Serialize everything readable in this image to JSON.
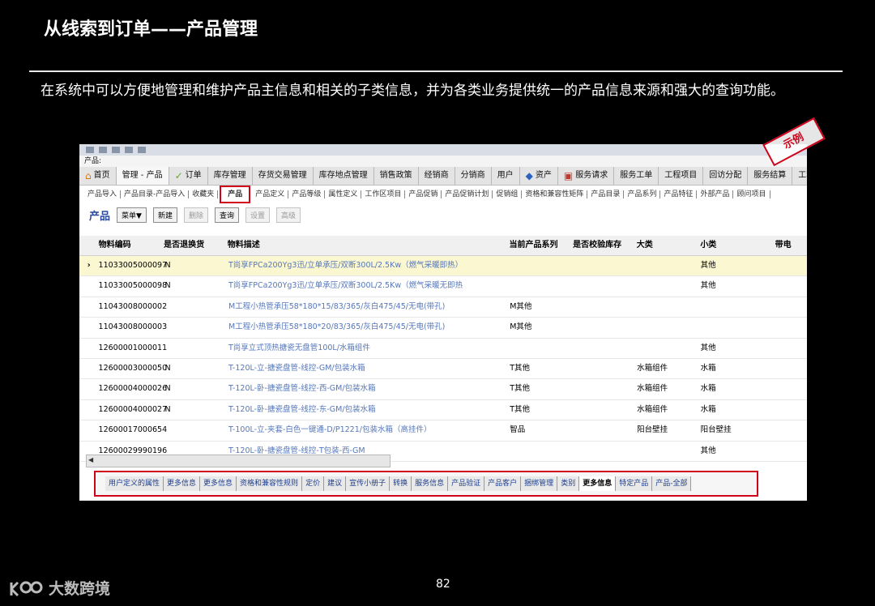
{
  "slide": {
    "title": "从线索到订单——产品管理",
    "description": "在系统中可以方便地管理和维护产品主信息和相关的子类信息，并为各类业务提供统一的产品信息来源和强大的查询功能。",
    "page_number": "82",
    "logo_text": "大数跨境",
    "stamp_text": "示例"
  },
  "app": {
    "breadcrumb": "产品:",
    "tabs": [
      {
        "label": "首页",
        "icon": "home-icon"
      },
      {
        "label": "管理 - 产品",
        "icon": ""
      },
      {
        "label": "订单",
        "icon": "order-icon"
      },
      {
        "label": "库存管理",
        "icon": ""
      },
      {
        "label": "存货交易管理",
        "icon": ""
      },
      {
        "label": "库存地点管理",
        "icon": ""
      },
      {
        "label": "销售政策",
        "icon": ""
      },
      {
        "label": "经销商",
        "icon": ""
      },
      {
        "label": "分销商",
        "icon": ""
      },
      {
        "label": "用户",
        "icon": ""
      },
      {
        "label": "资产",
        "icon": "asset-icon"
      },
      {
        "label": "服务请求",
        "icon": "briefcase-icon"
      },
      {
        "label": "服务工单",
        "icon": ""
      },
      {
        "label": "工程项目",
        "icon": ""
      },
      {
        "label": "回访分配",
        "icon": ""
      },
      {
        "label": "服务结算",
        "icon": ""
      },
      {
        "label": "工程",
        "icon": ""
      }
    ],
    "subtabs": [
      "产品导入",
      "产品目录-产品导入",
      "收藏夹",
      "产品",
      "产品定义",
      "产品等级",
      "属性定义",
      "工作区项目",
      "产品促销",
      "产品促销计划",
      "促销组",
      "资格和兼容性矩阵",
      "产品目录",
      "产品系列",
      "产品特征",
      "外部产品",
      "顾问项目"
    ],
    "active_subtab": "产品",
    "section_title": "产品",
    "menu_button": "菜单▼",
    "buttons": {
      "new": "新建",
      "delete": "删除",
      "query": "查询",
      "btn4": "设置",
      "btn5": "高级"
    },
    "columns": [
      "物料编码",
      "是否退换货",
      "物料描述",
      "当前产品系列",
      "是否校验库存",
      "大类",
      "小类",
      "带电"
    ],
    "rows": [
      {
        "code": "11033005000097",
        "returnable": "N",
        "desc": "T尚享FPCa200Yg3迅/立单承压/双断300L/2.5Kw（燃气采暖即热）",
        "series": "",
        "check_stock": "",
        "category": "",
        "subcategory": "其他",
        "selected": true
      },
      {
        "code": "11033005000098",
        "returnable": "N",
        "desc": "T尚享FPCa200Yg3迅/立单承压/双断300L/2.5Kw（燃气采暖无即热",
        "series": "",
        "check_stock": "",
        "category": "",
        "subcategory": "其他"
      },
      {
        "code": "11043008000002",
        "returnable": "",
        "desc": "M工程小热管承压58*180*15/83/365/灰白475/45/无电(带孔)",
        "series": "M其他",
        "check_stock": "",
        "category": "",
        "subcategory": ""
      },
      {
        "code": "11043008000003",
        "returnable": "",
        "desc": "M工程小热管承压58*180*20/83/365/灰白475/45/无电(带孔)",
        "series": "M其他",
        "check_stock": "",
        "category": "",
        "subcategory": ""
      },
      {
        "code": "12600001000011",
        "returnable": "",
        "desc": "T尚享立式顶热搪瓷无盘管100L/水箱组件",
        "series": "",
        "check_stock": "",
        "category": "",
        "subcategory": "其他"
      },
      {
        "code": "12600003000050",
        "returnable": "N",
        "desc": "T-120L-立-搪瓷盘管-线控-GM/包装水箱",
        "series": "T其他",
        "check_stock": "",
        "category": "水箱组件",
        "subcategory": "水箱"
      },
      {
        "code": "12600004000026",
        "returnable": "N",
        "desc": "T-120L-卧-搪瓷盘管-线控-西-GM/包装水箱",
        "series": "T其他",
        "check_stock": "",
        "category": "水箱组件",
        "subcategory": "水箱"
      },
      {
        "code": "12600004000027",
        "returnable": "N",
        "desc": "T-120L-卧-搪瓷盘管-线控-东-GM/包装水箱",
        "series": "T其他",
        "check_stock": "",
        "category": "水箱组件",
        "subcategory": "水箱"
      },
      {
        "code": "12600017000654",
        "returnable": "",
        "desc": "T-100L-立-夹套-白色一键通-D/P1221/包装水箱（高挂件）",
        "series": "智品",
        "check_stock": "",
        "category": "阳台壁挂",
        "subcategory": "阳台壁挂"
      },
      {
        "code": "12600029990196",
        "returnable": "",
        "desc": "T-120L-卧-搪瓷盘管-线控-T包装-西-GM",
        "series": "",
        "check_stock": "",
        "category": "",
        "subcategory": "其他"
      }
    ],
    "bottom_tabs": [
      "用户定义的属性",
      "更多信息",
      "更多信息",
      "资格和兼容性规则",
      "定价",
      "建议",
      "宣传小册子",
      "转换",
      "服务信息",
      "产品验证",
      "产品客户",
      "捆绑管理",
      "类别",
      "更多信息",
      "特定产品",
      "产品-全部"
    ],
    "active_bottom_tab": 13
  },
  "colors": {
    "accent_red": "#d0021b",
    "link_blue": "#5577bb",
    "selected_row": "#fbf7d0"
  }
}
